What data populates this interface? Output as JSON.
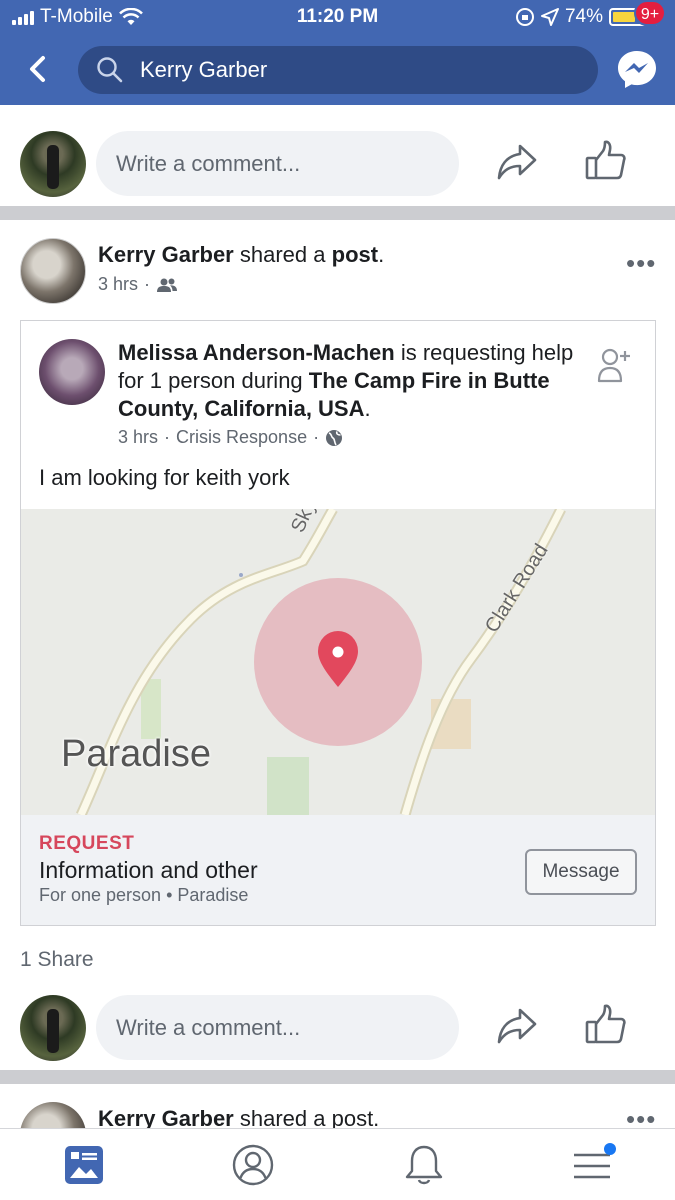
{
  "status_bar": {
    "carrier": "T-Mobile",
    "time": "11:20 PM",
    "battery": "74%",
    "battery_level": 0.74
  },
  "header": {
    "search_value": "Kerry Garber",
    "messenger_badge": "9+",
    "accent_color": "#4267b2"
  },
  "comment_box": {
    "placeholder": "Write a comment..."
  },
  "post": {
    "author": "Kerry Garber",
    "action": "shared a",
    "object": "post",
    "period": ".",
    "time": "3 hrs",
    "audience_icon": "friends-icon",
    "more": "•••",
    "shared": {
      "author": "Melissa Anderson-Machen",
      "text_mid": "is requesting help for 1 person during",
      "event": "The Camp Fire in Butte County, California, USA",
      "text_end": ".",
      "time": "3 hrs",
      "source": "Crisis Response",
      "body": "I am looking for keith york",
      "map": {
        "place_label": "Paradise",
        "road_1": "Skyw",
        "road_2": "Clark Road"
      },
      "request": {
        "label": "REQUEST",
        "title": "Information and other",
        "subtitle": "For one person • Paradise",
        "button": "Message"
      }
    },
    "shares": "1 Share"
  },
  "next_post": {
    "author": "Kerry Garber",
    "action": "shared a post."
  },
  "tabs": [
    "news-feed",
    "profile",
    "notifications",
    "menu"
  ]
}
